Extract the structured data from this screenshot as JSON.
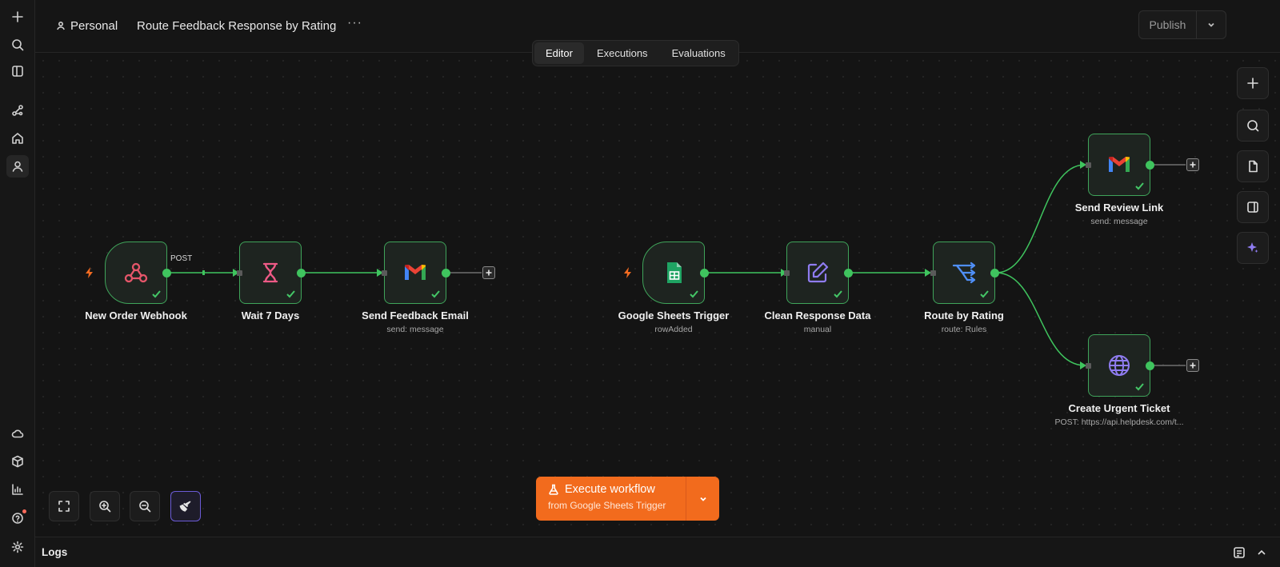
{
  "header": {
    "project": "Personal",
    "workflow_title": "Route Feedback Response by Rating",
    "more": "···",
    "publish_label": "Publish"
  },
  "tabs": [
    {
      "label": "Editor",
      "active": true
    },
    {
      "label": "Executions",
      "active": false
    },
    {
      "label": "Evaluations",
      "active": false
    }
  ],
  "sidebar": {
    "icons": [
      "plus-icon",
      "search-icon",
      "panel-icon",
      "workflows-icon",
      "home-icon",
      "user-icon",
      "cloud-icon",
      "cube-icon",
      "chart-icon",
      "help-icon",
      "gear-icon"
    ]
  },
  "nodes": [
    {
      "title": "New Order Webhook",
      "subtitle": "",
      "icon": "webhook-icon"
    },
    {
      "title": "Wait 7 Days",
      "subtitle": "",
      "icon": "hourglass-icon"
    },
    {
      "title": "Send Feedback Email",
      "subtitle": "send: message",
      "icon": "gmail-icon"
    },
    {
      "title": "Google Sheets Trigger",
      "subtitle": "rowAdded",
      "icon": "sheets-icon"
    },
    {
      "title": "Clean Response Data",
      "subtitle": "manual",
      "icon": "edit-icon"
    },
    {
      "title": "Route by Rating",
      "subtitle": "route: Rules",
      "icon": "switch-icon"
    },
    {
      "title": "Send Review Link",
      "subtitle": "send: message",
      "icon": "gmail-icon"
    },
    {
      "title": "Create Urgent Ticket",
      "subtitle": "POST: https://api.helpdesk.com/t...",
      "icon": "globe-icon"
    }
  ],
  "connection_label": "POST",
  "execute": {
    "title": "Execute workflow",
    "subtitle": "from Google Sheets Trigger"
  },
  "logs": {
    "label": "Logs"
  },
  "colors": {
    "accent": "#f26b1d",
    "node_border": "#3fa45a",
    "connection": "#3fc45e"
  }
}
